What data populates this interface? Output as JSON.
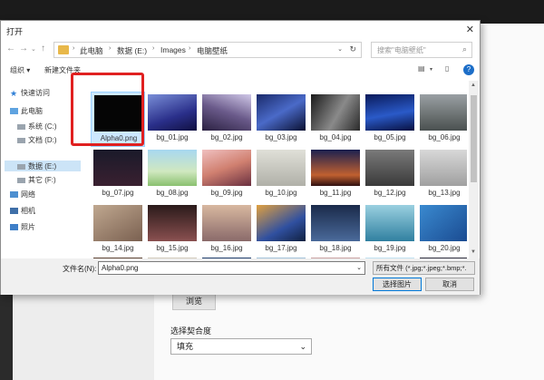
{
  "background_app": {
    "browse_label": "浏览",
    "adapt_label": "选择契合度",
    "adapt_value": "填充"
  },
  "dialog": {
    "title": "打开",
    "breadcrumb": [
      "此电脑",
      "数据 (E:)",
      "Images",
      "电脑壁纸"
    ],
    "search_placeholder": "搜索\"电脑壁纸\"",
    "organize_label": "组织 ▾",
    "new_folder_label": "新建文件夹",
    "nav_pane": [
      {
        "label": "快速访问",
        "icon": "star-icon"
      },
      {
        "label": "此电脑",
        "icon": "computer-icon"
      },
      {
        "label": "系统 (C:)",
        "icon": "drive-icon"
      },
      {
        "label": "文档 (D:)",
        "icon": "drive-icon"
      },
      {
        "label": "数据 (E:)",
        "icon": "drive-icon"
      },
      {
        "label": "其它 (F:)",
        "icon": "drive-icon"
      },
      {
        "label": "网络",
        "icon": "network-icon"
      },
      {
        "label": "相机",
        "icon": "camera-icon"
      },
      {
        "label": "照片",
        "icon": "photo-icon"
      }
    ],
    "files": [
      "Alpha0.png",
      "bg_01.jpg",
      "bg_02.jpg",
      "bg_03.jpg",
      "bg_04.jpg",
      "bg_05.jpg",
      "bg_06.jpg",
      "bg_07.jpg",
      "bg_08.jpg",
      "bg_09.jpg",
      "bg_10.jpg",
      "bg_11.jpg",
      "bg_12.jpg",
      "bg_13.jpg",
      "bg_14.jpg",
      "bg_15.jpg",
      "bg_16.jpg",
      "bg_17.jpg",
      "bg_18.jpg",
      "bg_19.jpg",
      "bg_20.jpg",
      "",
      "",
      "",
      "",
      "",
      "",
      ""
    ],
    "filename_label": "文件名(N):",
    "filename_value": "Alpha0.png",
    "filetype_value": "所有文件 (*.jpg;*.jpeg;*.bmp;*.",
    "open_button": "选择图片",
    "cancel_button": "取消"
  },
  "colors": {
    "highlight": "#e02020",
    "selection": "#cce8ff",
    "accent": "#0078d7"
  }
}
